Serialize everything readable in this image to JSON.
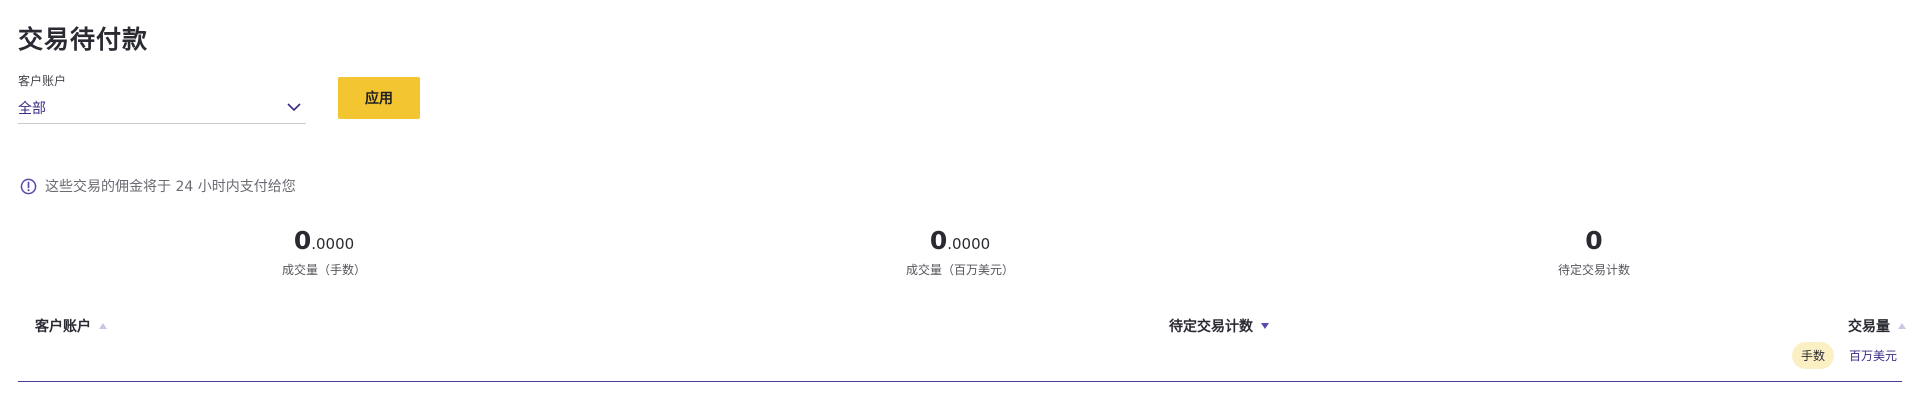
{
  "page": {
    "title": "交易待付款"
  },
  "filter": {
    "label": "客户账户",
    "selected": "全部",
    "apply_label": "应用"
  },
  "info": {
    "text": "这些交易的佣金将于 24 小时内支付给您"
  },
  "stats": [
    {
      "integer": "0",
      "decimal": ".0000",
      "label": "成交量（手数）"
    },
    {
      "integer": "0",
      "decimal": ".0000",
      "label": "成交量（百万美元）"
    },
    {
      "integer": "0",
      "decimal": "",
      "label": "待定交易计数"
    }
  ],
  "table": {
    "columns": [
      {
        "label": "客户账户",
        "sort": "asc-inactive"
      },
      {
        "label": "待定交易计数",
        "sort": "desc-active"
      },
      {
        "label": "交易量",
        "sort": "asc-inactive"
      }
    ],
    "units": {
      "active": "手数",
      "inactive": "百万美元"
    },
    "rows": []
  },
  "colors": {
    "accent": "#f2c531",
    "brand": "#3b2a84",
    "sort_inactive": "#c9c6e6",
    "sort_active": "#5b4aad"
  },
  "icons": {
    "select": "chevron-down-icon",
    "info": "info-circle-icon",
    "sort": "sort-triangle-icon"
  }
}
